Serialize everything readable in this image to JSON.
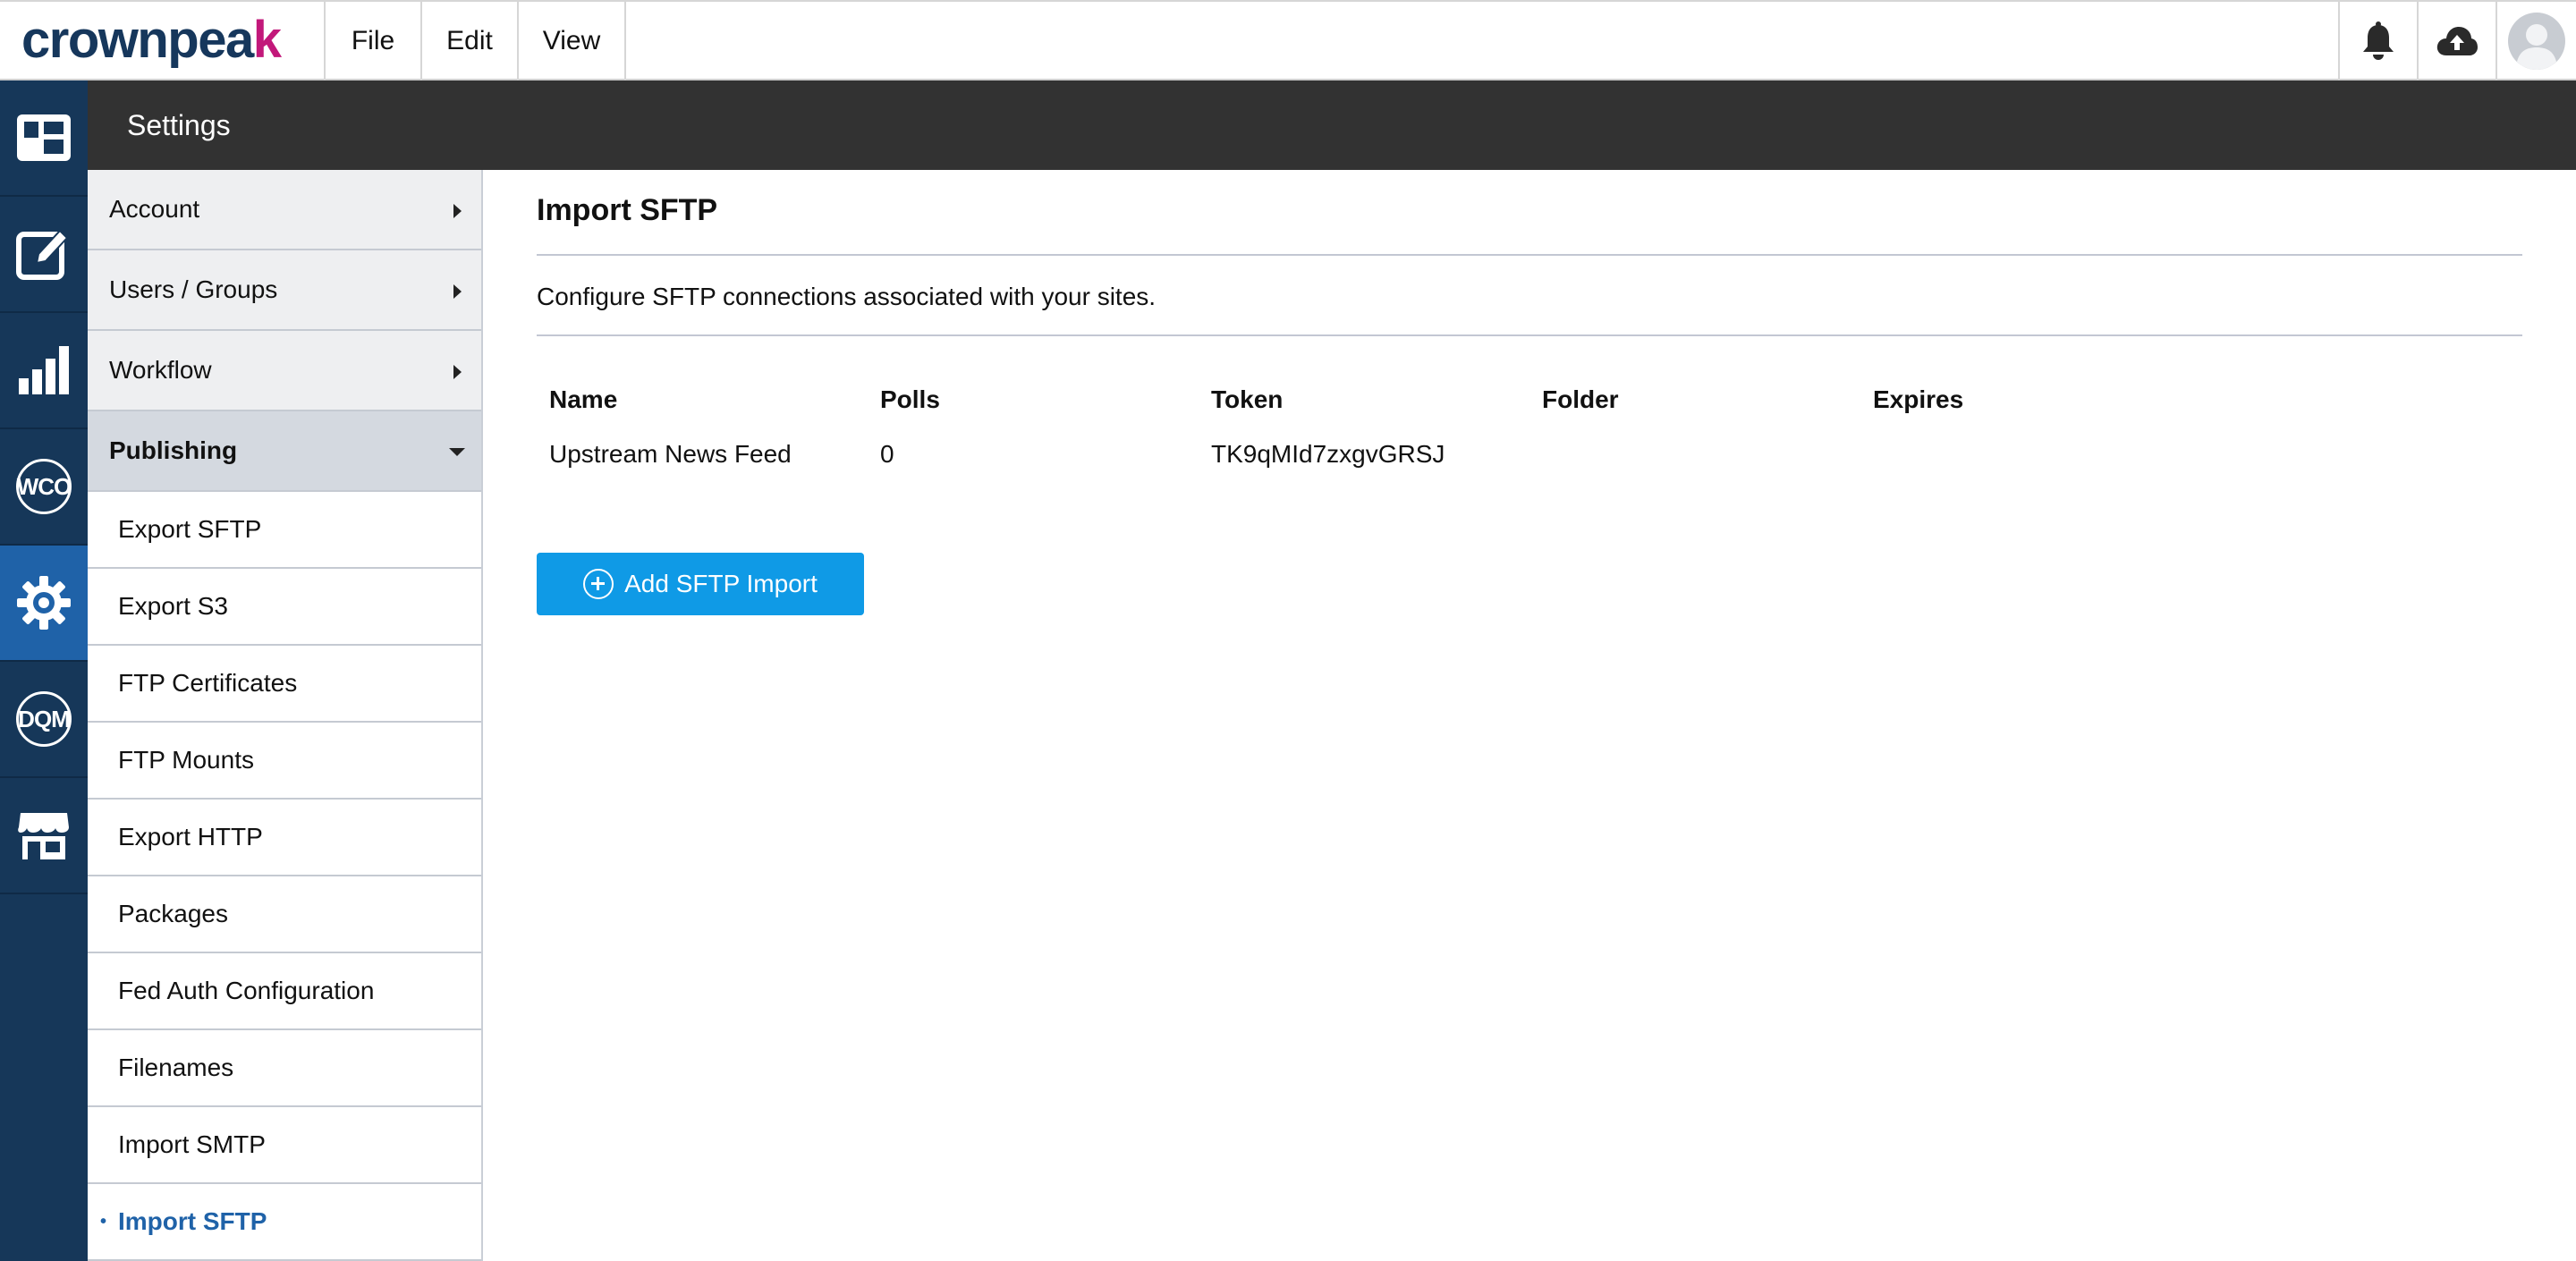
{
  "topbar": {
    "logo_prefix": "crownpea",
    "logo_accent": "k",
    "menu": [
      "File",
      "Edit",
      "View"
    ],
    "icons": [
      "bell-icon",
      "cloud-upload-icon",
      "user-avatar-icon"
    ]
  },
  "rail": {
    "items": [
      {
        "name": "dashboard-icon"
      },
      {
        "name": "edit-icon"
      },
      {
        "name": "analytics-icon"
      },
      {
        "name": "wco-icon",
        "label": "WCO"
      },
      {
        "name": "settings-gear-icon",
        "active": true
      },
      {
        "name": "dqm-icon",
        "label": "DQM"
      },
      {
        "name": "marketplace-icon"
      }
    ]
  },
  "header": {
    "title": "Settings"
  },
  "sidebar": {
    "sections": [
      {
        "label": "Account"
      },
      {
        "label": "Users / Groups"
      },
      {
        "label": "Workflow"
      },
      {
        "label": "Publishing"
      }
    ],
    "publishing_items": [
      "Export SFTP",
      "Export S3",
      "FTP Certificates",
      "FTP Mounts",
      "Export HTTP",
      "Packages",
      "Fed Auth Configuration",
      "Filenames",
      "Import SMTP",
      "Import SFTP"
    ]
  },
  "main": {
    "title": "Import SFTP",
    "description": "Configure SFTP connections associated with your sites.",
    "table": {
      "headers": [
        "Name",
        "Polls",
        "Token",
        "Folder",
        "Expires"
      ],
      "rows": [
        [
          "Upstream News Feed",
          "0",
          "TK9qMId7zxgvGRSJ",
          "",
          ""
        ]
      ]
    },
    "add_button_label": "Add SFTP Import"
  },
  "colors": {
    "brand_navy": "#16375c",
    "brand_magenta": "#c2187a",
    "rail_bg": "#163759",
    "rail_active": "#1f62a8",
    "header_bg": "#323232",
    "button_blue": "#0f9ae6"
  }
}
